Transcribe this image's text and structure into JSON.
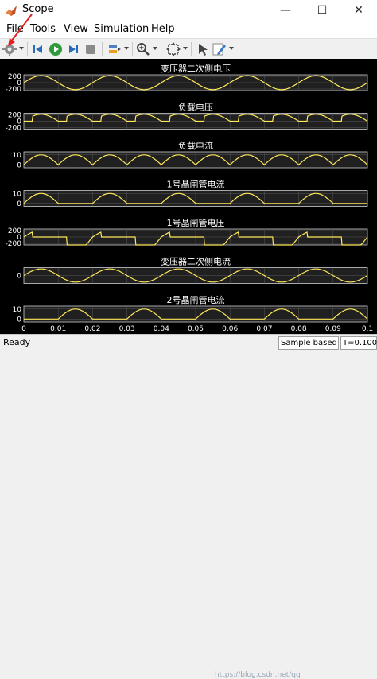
{
  "window": {
    "title": "Scope"
  },
  "menu": [
    "File",
    "Tools",
    "View",
    "Simulation",
    "Help"
  ],
  "toolbar_icons": [
    "settings-icon",
    "rewind-icon",
    "run-icon",
    "step-forward-icon",
    "stop-icon",
    "highlight-icon",
    "zoom-icon",
    "fit-icon",
    "cursor-icon",
    "edit-icon"
  ],
  "colors": {
    "plot_bg": "#000000",
    "axes_bg": "#202020",
    "grid": "#585858",
    "signal": "#ffe85a",
    "annotation_arrow": "#e02020"
  },
  "status": {
    "ready": "Ready",
    "mode": "Sample based",
    "time": "T=0.100",
    "watermark": "https://blog.csdn.net/qq"
  },
  "chart_data": [
    {
      "type": "line",
      "title": "变压器二次侧电压",
      "ylabel": "",
      "yticks": [
        "200",
        "0",
        "-200"
      ],
      "ylim": [
        -250,
        250
      ],
      "x": [
        0,
        0.1
      ],
      "series": [
        {
          "shape": "sine",
          "amplitude": 220,
          "frequency_hz": 50,
          "phase": 0
        }
      ]
    },
    {
      "type": "line",
      "title": "负载电压",
      "ylabel": "",
      "yticks": [
        "200",
        "0",
        "-200"
      ],
      "ylim": [
        -250,
        250
      ],
      "x": [
        0,
        0.1
      ],
      "series": [
        {
          "shape": "controlled_rectifier",
          "amplitude": 220,
          "frequency_hz": 50,
          "firing_angle_deg": 45
        }
      ]
    },
    {
      "type": "line",
      "title": "负载电流",
      "ylabel": "",
      "yticks": [
        "10",
        "0"
      ],
      "ylim": [
        -3,
        13
      ],
      "x": [
        0,
        0.1
      ],
      "series": [
        {
          "shape": "rectified_abs",
          "amplitude": 10,
          "frequency_hz": 50
        }
      ]
    },
    {
      "type": "line",
      "title": "1号晶闸管电流",
      "ylabel": "",
      "yticks": [
        "10",
        "0"
      ],
      "ylim": [
        -3,
        13
      ],
      "x": [
        0,
        0.1
      ],
      "series": [
        {
          "shape": "half_positive",
          "amplitude": 10,
          "frequency_hz": 50
        }
      ]
    },
    {
      "type": "line",
      "title": "1号晶闸管电压",
      "ylabel": "",
      "yticks": [
        "200",
        "0",
        "-200"
      ],
      "ylim": [
        -250,
        250
      ],
      "x": [
        0,
        0.1
      ],
      "series": [
        {
          "shape": "thyristor_voltage",
          "amplitude": 220,
          "frequency_hz": 50,
          "firing_angle_deg": 45
        }
      ]
    },
    {
      "type": "line",
      "title": "变压器二次侧电流",
      "ylabel": "",
      "yticks": [
        "0"
      ],
      "ylim": [
        -12,
        12
      ],
      "x": [
        0,
        0.1
      ],
      "series": [
        {
          "shape": "sine",
          "amplitude": 10,
          "frequency_hz": 50,
          "phase": 0
        }
      ]
    },
    {
      "type": "line",
      "title": "2号晶闸管电流",
      "ylabel": "",
      "yticks": [
        "10",
        "0"
      ],
      "ylim": [
        -3,
        13
      ],
      "x": [
        0,
        0.1
      ],
      "series": [
        {
          "shape": "half_negative",
          "amplitude": 10,
          "frequency_hz": 50
        }
      ],
      "xticks": [
        "0",
        "0.01",
        "0.02",
        "0.03",
        "0.04",
        "0.05",
        "0.06",
        "0.07",
        "0.08",
        "0.09",
        "0.1"
      ]
    }
  ]
}
